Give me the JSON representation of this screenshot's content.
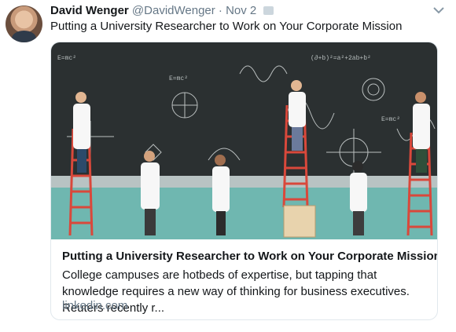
{
  "tweet": {
    "author_name": "David Wenger",
    "handle": "@DavidWenger",
    "separator": "·",
    "date": "Nov 2",
    "text": "Putting a University Researcher to Work on Your Corporate Mission"
  },
  "card": {
    "title": "Putting a University Researcher to Work on Your Corporate Mission",
    "description": "College campuses are hotbeds of expertise, but tapping that knowledge requires a new way of thinking for business executives. Reuters recently r...",
    "domain": "linkedin.com",
    "image": {
      "chalk_formula": "E=mc²",
      "chalk_formula_2": "(∂+b)²=a²+2ab+b²"
    }
  },
  "colors": {
    "chalkboard": "#2b3031",
    "floor": "#6fb7b0",
    "ladder": "#d9483b",
    "coat": "#f7f7f7",
    "link_gray": "#657786"
  }
}
